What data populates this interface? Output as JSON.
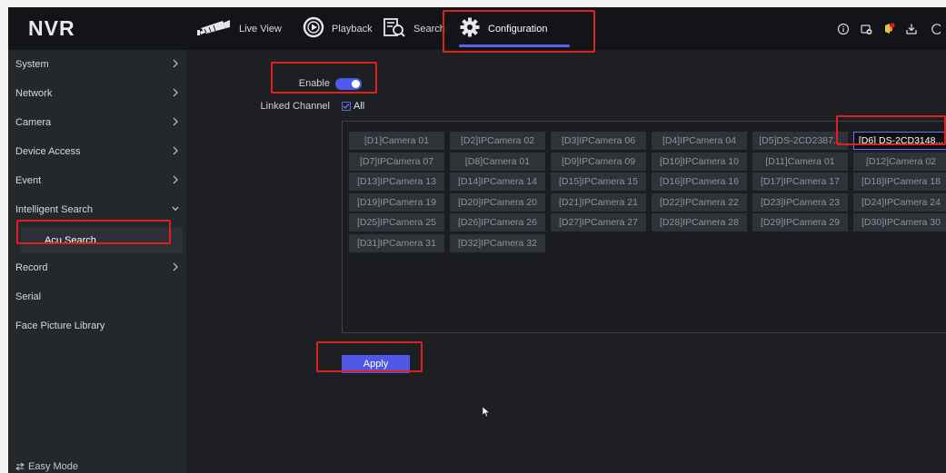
{
  "app": {
    "logo": "NVR"
  },
  "header": {
    "nav": [
      {
        "label": "Live View",
        "icon": "camera-icon"
      },
      {
        "label": "Playback",
        "icon": "playback-icon"
      },
      {
        "label": "Search",
        "icon": "search-icon"
      },
      {
        "label": "Configuration",
        "icon": "gear-icon"
      }
    ],
    "active": "Configuration",
    "right_icons": [
      "info-icon",
      "alarm-icon",
      "notification-icon",
      "download-icon"
    ]
  },
  "sidebar": {
    "items": [
      {
        "label": "System",
        "chevron": "right"
      },
      {
        "label": "Network",
        "chevron": "right"
      },
      {
        "label": "Camera",
        "chevron": "right"
      },
      {
        "label": "Device Access",
        "chevron": "right"
      },
      {
        "label": "Event",
        "chevron": "right"
      },
      {
        "label": "Intelligent Search",
        "chevron": "down"
      },
      {
        "label": "Acu Search",
        "sub": true,
        "selected": true
      },
      {
        "label": "Record",
        "chevron": "right"
      },
      {
        "label": "Serial",
        "chevron": ""
      },
      {
        "label": "Face Picture Library",
        "chevron": ""
      }
    ],
    "easy_mode": "Easy Mode"
  },
  "form": {
    "enable_label": "Enable",
    "enable_on": true,
    "linked_channel_label": "Linked Channel",
    "all_label": "All",
    "all_checked": true
  },
  "channels": [
    "[D1]Camera 01",
    "[D2]IPCamera 02",
    "[D3]IPCamera 06",
    "[D4]IPCamera 04",
    "[D5]DS-2CD2387...",
    "[D6] DS-2CD3148...",
    "[D7]IPCamera 07",
    "[D8]Camera 01",
    "[D9]IPCamera 09",
    "[D10]IPCamera 10",
    "[D11]Camera 01",
    "[D12]Camera 02",
    "[D13]IPCamera 13",
    "[D14]IPCamera 14",
    "[D15]IPCamera 15",
    "[D16]IPCamera 16",
    "[D17]IPCamera 17",
    "[D18]IPCamera 18",
    "[D19]IPCamera 19",
    "[D20]IPCamera 20",
    "[D21]IPCamera 21",
    "[D22]IPCamera 22",
    "[D23]IPCamera 23",
    "[D24]IPCamera 24",
    "[D25]IPCamera 25",
    "[D26]IPCamera 26",
    "[D27]IPCamera 27",
    "[D28]IPCamera 28",
    "[D29]IPCamera 29",
    "[D30]IPCamera 30",
    "[D31]IPCamera 31",
    "[D32]IPCamera 32"
  ],
  "selected_channel": "[D6] DS-2CD3148...",
  "apply_label": "Apply",
  "colors": {
    "accent": "#4f58e6",
    "highlight": "#e0201c",
    "background": "#1d1f23",
    "sidebar": "#24272c"
  }
}
